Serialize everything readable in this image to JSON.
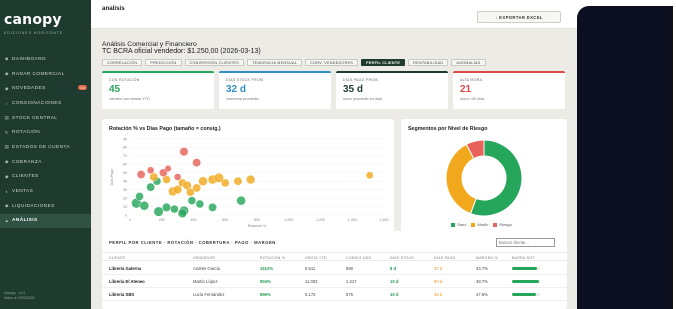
{
  "sidebar": {
    "logo": "canopy",
    "logo_sub": "EDICIONES HORIZONTE",
    "items": [
      {
        "icon": "◆",
        "label": "DASHBOARD",
        "active": false
      },
      {
        "icon": "◆",
        "label": "RADAR COMERCIAL",
        "active": false
      },
      {
        "icon": "◆",
        "label": "NOVEDADES",
        "active": false,
        "badge": "14"
      },
      {
        "icon": "○",
        "label": "CONSIGNACIONES",
        "active": false
      },
      {
        "icon": "▤",
        "label": "STOCK CENTRAL",
        "active": false
      },
      {
        "icon": "↻",
        "label": "ROTACIÓN",
        "active": false
      },
      {
        "icon": "▤",
        "label": "ESTADOS DE CUENTA",
        "active": false
      },
      {
        "icon": "◆",
        "label": "COBRANZA",
        "active": false
      },
      {
        "icon": "◆",
        "label": "CLIENTES",
        "active": false
      },
      {
        "icon": "◐",
        "label": "VENTAS",
        "active": false
      },
      {
        "icon": "◆",
        "label": "LIQUIDACIONES",
        "active": false
      },
      {
        "icon": "▲",
        "label": "ANÁLISIS",
        "active": true
      }
    ],
    "footer_line1": "Canopy · v1.0",
    "footer_line2": "Datos al 13/03/2026"
  },
  "topbar": {
    "title": "analisis",
    "export_label": "↓ EXPORTAR EXCEL"
  },
  "header": {
    "title": "Análisis Comercial y Financiero",
    "subtitle": "TC BCRA oficial vendedor: $1.250,00 (2026-03-13)"
  },
  "tabs": [
    {
      "label": "CORRELACIÓN",
      "active": false
    },
    {
      "label": "PREDICCIÓN",
      "active": false
    },
    {
      "label": "CONVERSIÓN CLIENTES",
      "active": false
    },
    {
      "label": "TENDENCIA MENSUAL",
      "active": false
    },
    {
      "label": "CONV. VENDEDORES",
      "active": false
    },
    {
      "label": "PERFIL CLIENTE",
      "active": true
    },
    {
      "label": "RENTABILIDAD",
      "active": false
    },
    {
      "label": "ANOMALÍAS",
      "active": false
    }
  ],
  "kpis": [
    {
      "label": "CON ROTACIÓN",
      "value": "45",
      "desc": "clientes con ventas YTD",
      "color": "#26a65b"
    },
    {
      "label": "DÍAS STOCK PROM.",
      "value": "32 d",
      "desc": "cobertura promedio",
      "color": "#2d8fc4"
    },
    {
      "label": "DÍAS PAGO PROM.",
      "value": "35 d",
      "desc": "mora promedio en días",
      "color": "#1f3a2f"
    },
    {
      "label": "ALTA MORA",
      "value": "21",
      "desc": "mora >30 días",
      "color": "#e04848"
    }
  ],
  "colors": {
    "green": "#26a65b",
    "orange": "#f2a81d",
    "red": "#e8615a"
  },
  "scatter": {
    "title": "Rotación % vs Días Pago (tamaño = consig.)",
    "xlabel": "Rotación %",
    "ylabel": "Días Pago",
    "x_ticks": [
      "0",
      "200",
      "400",
      "600",
      "800",
      "1,000",
      "1,200",
      "1,400",
      "1,600"
    ],
    "y_ticks": [
      "0",
      "10",
      "20",
      "30",
      "40",
      "50",
      "60",
      "70",
      "80",
      "90"
    ]
  },
  "chart_data": [
    {
      "type": "scatter",
      "title": "Rotación % vs Días Pago (tamaño = consig.)",
      "xlabel": "Rotación %",
      "ylabel": "Días Pago",
      "xlim": [
        0,
        1600
      ],
      "ylim": [
        0,
        90
      ],
      "series": [
        {
          "name": "Sano",
          "color": "#26a65b",
          "points": [
            {
              "x": 40,
              "y": 14,
              "r": 3.9
            },
            {
              "x": 60,
              "y": 22,
              "r": 3.2
            },
            {
              "x": 90,
              "y": 11,
              "r": 3.6
            },
            {
              "x": 130,
              "y": 33,
              "r": 3.3
            },
            {
              "x": 180,
              "y": 4,
              "r": 3.8
            },
            {
              "x": 230,
              "y": 9,
              "r": 3.4
            },
            {
              "x": 280,
              "y": 7,
              "r": 3.2
            },
            {
              "x": 340,
              "y": 5,
              "r": 3.7
            },
            {
              "x": 390,
              "y": 17,
              "r": 3.2
            },
            {
              "x": 440,
              "y": 13,
              "r": 3.2
            },
            {
              "x": 520,
              "y": 9,
              "r": 3.3
            },
            {
              "x": 700,
              "y": 17,
              "r": 3.6
            },
            {
              "x": 330,
              "y": 2,
              "r": 3.5
            },
            {
              "x": 170,
              "y": 40,
              "r": 3.2
            }
          ]
        },
        {
          "name": "Medio",
          "color": "#f2a81d",
          "points": [
            {
              "x": 150,
              "y": 45,
              "r": 3.3
            },
            {
              "x": 230,
              "y": 42,
              "r": 3.2
            },
            {
              "x": 270,
              "y": 28,
              "r": 3.6
            },
            {
              "x": 300,
              "y": 30,
              "r": 3.4
            },
            {
              "x": 330,
              "y": 38,
              "r": 3.2
            },
            {
              "x": 360,
              "y": 35,
              "r": 3.4
            },
            {
              "x": 420,
              "y": 32,
              "r": 3.3
            },
            {
              "x": 460,
              "y": 40,
              "r": 3.6
            },
            {
              "x": 520,
              "y": 42,
              "r": 3.6
            },
            {
              "x": 560,
              "y": 44,
              "r": 3.8
            },
            {
              "x": 600,
              "y": 38,
              "r": 3.2
            },
            {
              "x": 680,
              "y": 40,
              "r": 3.3
            },
            {
              "x": 760,
              "y": 42,
              "r": 3.5
            },
            {
              "x": 1510,
              "y": 47,
              "r": 2.9
            },
            {
              "x": 380,
              "y": 27,
              "r": 3.2
            }
          ]
        },
        {
          "name": "Riesgo",
          "color": "#e8615a",
          "points": [
            {
              "x": 70,
              "y": 48,
              "r": 3.3
            },
            {
              "x": 130,
              "y": 53,
              "r": 2.8
            },
            {
              "x": 210,
              "y": 50,
              "r": 3.2
            },
            {
              "x": 300,
              "y": 45,
              "r": 2.8
            },
            {
              "x": 340,
              "y": 75,
              "r": 3.4
            },
            {
              "x": 420,
              "y": 62,
              "r": 3.3
            },
            {
              "x": 240,
              "y": 55,
              "r": 2.6
            }
          ]
        }
      ]
    },
    {
      "type": "pie",
      "title": "Segmentos por Nivel de Riesgo",
      "categories": [
        "Sano",
        "Medio",
        "Riesgo"
      ],
      "values": [
        29,
        19,
        4
      ],
      "colors": [
        "#26a65b",
        "#f2a81d",
        "#e8615a"
      ],
      "legend": "bottom"
    }
  ],
  "donut": {
    "title": "Segmentos por Nivel de Riesgo",
    "legend": [
      "Sano",
      "Medio",
      "Riesgo"
    ]
  },
  "table": {
    "title": "PERFIL POR CLIENTE · ROTACIÓN · COBERTURA · PAGO · MARGEN",
    "search_placeholder": "Buscar cliente...",
    "headers": [
      "CLIENTE",
      "VENDEDOR",
      "ROTACIÓN %",
      "VENTA YTD",
      "CONSIG UDS",
      "DÍAS STOCK",
      "DÍAS PAGO",
      "MARGEN %",
      "BARRA ROT."
    ],
    "rows": [
      {
        "cliente": "Librería Galerna",
        "vendedor": "Andrés García",
        "rotacion": "1612%",
        "venta": "9.511",
        "consig": "590",
        "stock": "8 d",
        "pago": "37 d",
        "margen": "33.7%",
        "bar": 0.9
      },
      {
        "cliente": "Librería El Ateneo",
        "vendedor": "Martín López",
        "rotacion": "904%",
        "venta": "11.002",
        "consig": "1.217",
        "stock": "10 d",
        "pago": "50 d",
        "margen": "48.7%",
        "bar": 0.95
      },
      {
        "cliente": "Librería SBS",
        "vendedor": "Lucía Fernández",
        "rotacion": "896%",
        "venta": "5.172",
        "consig": "575",
        "stock": "10 d",
        "pago": "45 d",
        "margen": "47.6%",
        "bar": 0.85
      }
    ]
  }
}
